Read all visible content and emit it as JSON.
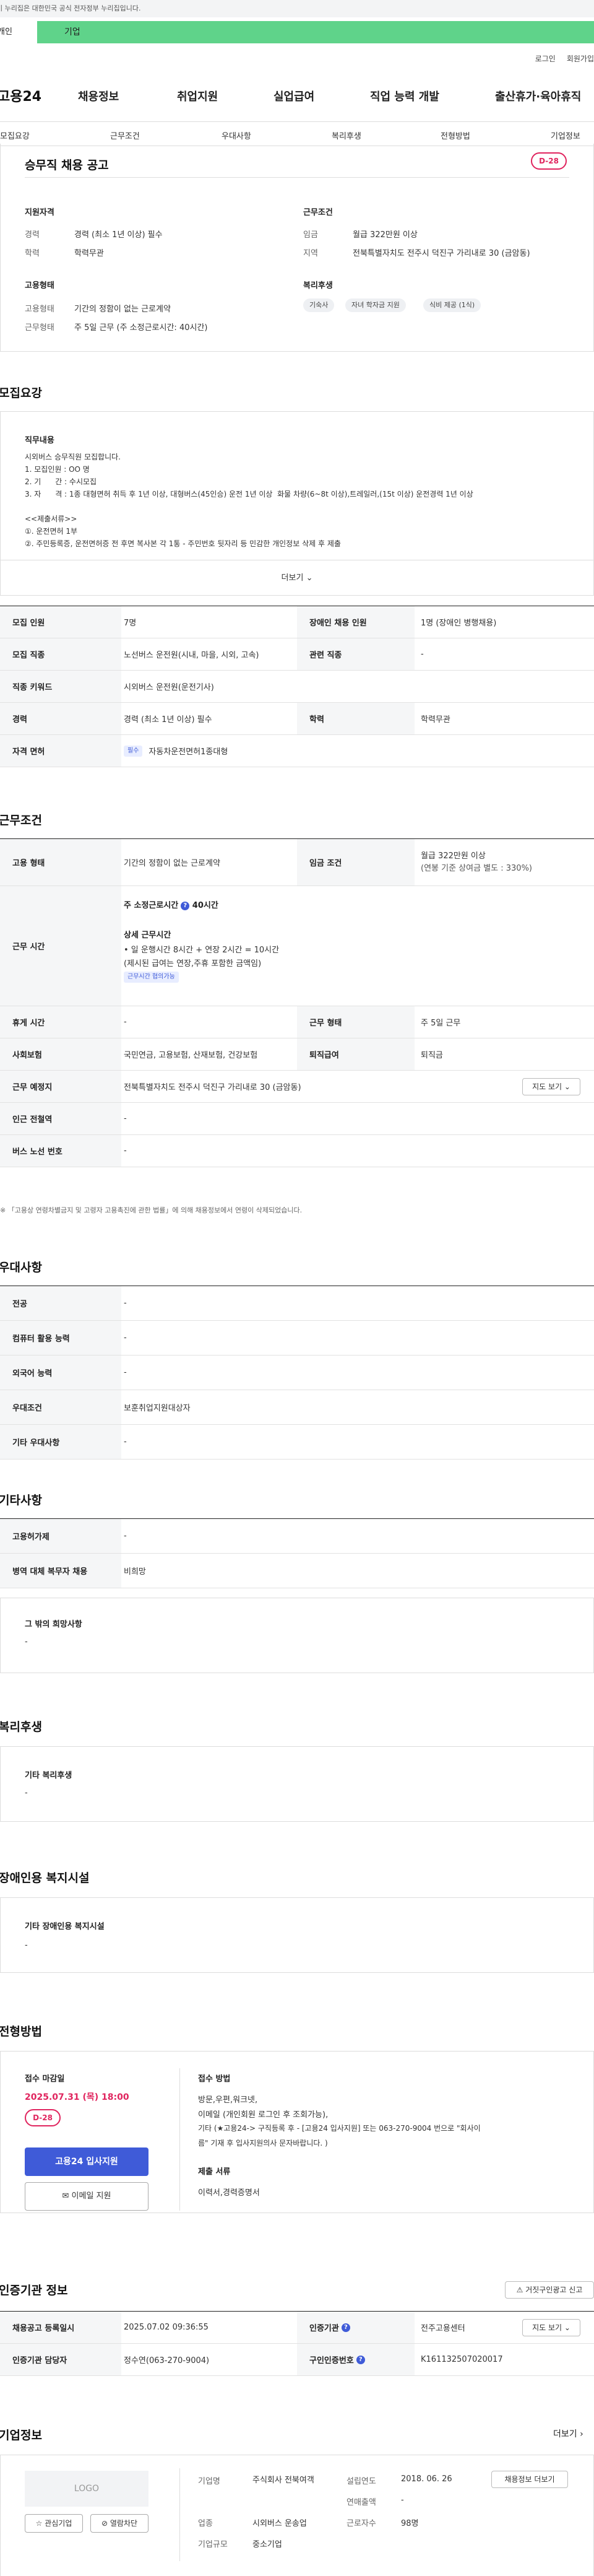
{
  "gov_notice": "이 누리집은 대한민국 공식 전자정부 누리집입니다.",
  "usertype": {
    "individual": "개인",
    "company": "기업"
  },
  "util": {
    "login": "로그인",
    "join": "회원가입"
  },
  "gnb": {
    "logo": "고용24",
    "menus": [
      "채용정보",
      "취업지원",
      "실업급여",
      "직업 능력 개발",
      "출산휴가·육아휴직"
    ]
  },
  "tabs": [
    "모집요강",
    "근무조건",
    "우대사항",
    "복리후생",
    "전형방법",
    "기업정보"
  ],
  "header": {
    "title": "승무직 채용 공고",
    "dday": "D-28"
  },
  "summary": {
    "qual": {
      "title": "지원자격",
      "rows": [
        {
          "label": "경력",
          "value": "경력 (최소 1년 이상) 필수"
        },
        {
          "label": "학력",
          "value": "학력무관"
        }
      ]
    },
    "cond": {
      "title": "근무조건",
      "rows": [
        {
          "label": "임금",
          "value": "월급 322만원 이상"
        },
        {
          "label": "지역",
          "value": "전북특별자치도 전주시 덕진구 가리내로 30 (금암동)"
        }
      ]
    },
    "emp": {
      "title": "고용형태",
      "rows": [
        {
          "label": "고용형태",
          "value": "기간의 정함이 없는 근로계약"
        },
        {
          "label": "근무형태",
          "value": "주 5일 근무 (주 소정근로시간: 40시간)"
        }
      ]
    },
    "welfare": {
      "title": "복리후생",
      "chips": [
        "기숙사",
        "자녀 학자금 지원",
        "식비 제공 (1식)"
      ]
    }
  },
  "recruit": {
    "title": "모집요강",
    "job_title": "직무내용",
    "job_desc": "시외버스 승무직원 모집합니다.\n1. 모집인원 : OO 명\n2. 기      간 : 수시모집\n3. 자      격 : 1종 대형면허 취득 후 1년 이상, 대형버스(45인승) 운전 1년 이상  화물 차량(6~8t 이상),트레일러,(15t 이상) 운전경력 1년 이상\n\n<<제출서류>>\n①. 운전면허 1부\n②. 주민등록증, 운전면허증 전 후면 복사본 각 1통 - 주민번호 뒷자리 등 민감한 개인정보 삭제 후 제출",
    "more": "더보기",
    "rows": [
      {
        "k": "모집 인원",
        "v": "7명",
        "k2": "장애인 채용 인원",
        "v2": "1명 (장애인 병행채용)"
      },
      {
        "k": "모집 직종",
        "v": "노선버스 운전원(시내, 마을, 시외, 고속)",
        "k2": "관련 직종",
        "v2": "-"
      },
      {
        "k": "직종 키워드",
        "v": "시외버스 운전원(운전기사)",
        "k2": "",
        "v2": ""
      },
      {
        "k": "경력",
        "v": "경력 (최소 1년 이상) 필수",
        "k2": "학력",
        "v2": "학력무관"
      },
      {
        "k": "자격 면허",
        "tag": "필수",
        "v": "자동차운전면허1종대형",
        "k2": "",
        "v2": ""
      }
    ]
  },
  "work": {
    "title": "근무조건",
    "emp_type": {
      "k": "고용 형태",
      "v": "기간의 정함이 없는 근로계약",
      "k2": "임금 조건",
      "v2a": "월급 322만원 이상",
      "v2b": "(연봉 기준 상여금 별도 : 330%)"
    },
    "hours": {
      "k": "근무 시간",
      "weekly": "주 소정근로시간",
      "weekly_q": "?",
      "weekly_val": "40시간",
      "detail_title": "상세 근무시간",
      "detail1": "• 일 운행시간 8시간 + 연장 2시간 = 10시간",
      "detail2": "(제시된 급여는 연장,주휴 포함한 금액임)",
      "tag": "근무시간 협의가능"
    },
    "rows": [
      {
        "k": "휴게 시간",
        "v": "-",
        "k2": "근무 형태",
        "v2": "주 5일 근무"
      },
      {
        "k": "사회보험",
        "v": "국민연금, 고용보험, 산재보험, 건강보험",
        "k2": "퇴직급여",
        "v2": "퇴직금"
      },
      {
        "k": "근무 예정지",
        "v": "전북특별자치도 전주시 덕진구 가리내로 30 (금암동)",
        "btn": "지도 보기"
      },
      {
        "k": "인근 전철역",
        "v": "-"
      },
      {
        "k": "버스 노선 번호",
        "v": "-"
      }
    ],
    "note": "※ 「고용상 연령차별금지 및 고령자 고용촉진에 관한 법률」에 의해 채용정보에서 연령이 삭제되었습니다."
  },
  "pref": {
    "title": "우대사항",
    "rows": [
      {
        "k": "전공",
        "v": "-"
      },
      {
        "k": "컴퓨터 활용 능력",
        "v": "-"
      },
      {
        "k": "외국어 능력",
        "v": "-"
      },
      {
        "k": "우대조건",
        "v": "보훈취업지원대상자"
      },
      {
        "k": "기타 우대사항",
        "v": "-"
      }
    ]
  },
  "etc": {
    "title": "기타사항",
    "rows": [
      {
        "k": "고용허가제",
        "v": "-"
      },
      {
        "k": "병역 대체 복무자 채용",
        "v": "비희망"
      }
    ],
    "box_title": "그 밖의 희망사항",
    "box_val": "-"
  },
  "welfare": {
    "title": "복리후생",
    "box_title": "기타 복리후생",
    "box_val": "-"
  },
  "disab": {
    "title": "장애인용 복지시설",
    "box_title": "기타 장애인용 복지시설",
    "box_val": "-"
  },
  "process": {
    "title": "전형방법",
    "deadline_label": "접수 마감일",
    "deadline": "2025.07.31 (목) 18:00",
    "dday": "D-28",
    "apply_btn": "고용24 입사지원",
    "email_btn": "이메일 지원",
    "method_title": "접수 방법",
    "method_lines": [
      "방문,우편,워크넷,",
      "이메일 (개인회원 로그인 후 조회가능),",
      "기타 (★고용24-> 구직등록 후 - [고용24 입사지원] 또는 063-270-9004 번으로 \"회사이",
      "름\" 기재 후 입사지원의사 문자바랍니다. )"
    ],
    "docs_title": "제출 서류",
    "docs": "이력서,경력증명서"
  },
  "agency": {
    "title": "인증기관 정보",
    "report_btn": "거짓구인광고 신고",
    "rows": [
      {
        "k": "채용공고 등록일시",
        "v": "2025.07.02 09:36:55",
        "k2": "인증기관",
        "v2": "전주고용센터",
        "btn": "지도 보기"
      },
      {
        "k": "인증기관 담당자",
        "v": "정수연(063-270-9004)",
        "k2": "구인인증번호",
        "v2": "K161132507020017"
      }
    ]
  },
  "company": {
    "title": "기업정보",
    "more": "더보기",
    "logo": "LOGO",
    "fav": "관심기업",
    "block": "열람차단",
    "name_label": "기업명",
    "name": "주식회사 전북여객",
    "ind_label": "업종",
    "ind": "시외버스 운송업",
    "size_label": "기업규모",
    "size": "중소기업",
    "est_label": "설립연도",
    "est": "2018. 06. 26",
    "sales_label": "연매출액",
    "sales": "-",
    "emp_label": "근로자수",
    "emp": "98명",
    "recruit_btn": "채용정보 더보기"
  }
}
